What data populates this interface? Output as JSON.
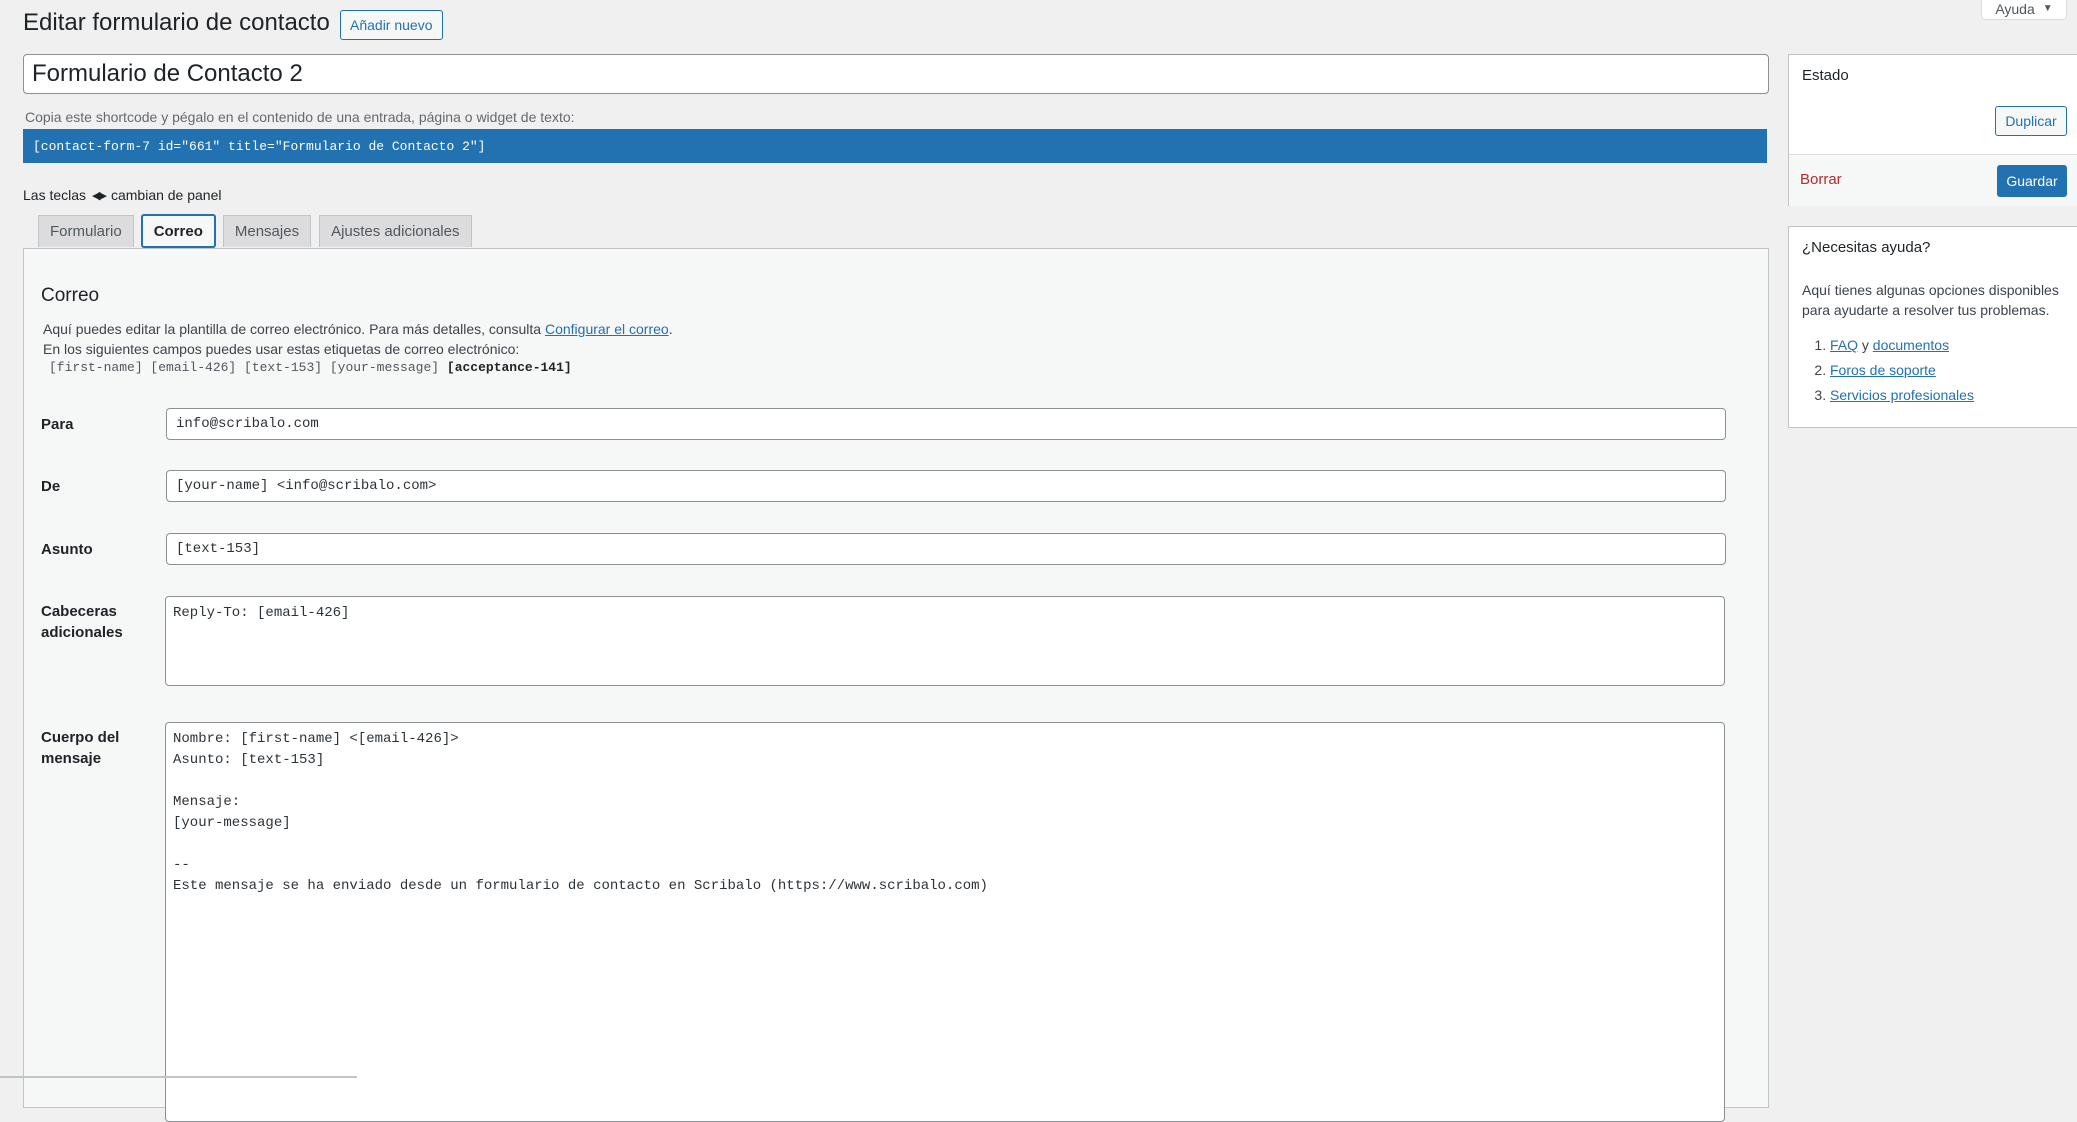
{
  "header": {
    "title": "Editar formulario de contacto",
    "add_new": "Añadir nuevo",
    "help": "Ayuda"
  },
  "form_title": "Formulario de Contacto 2",
  "shortcode": {
    "label": "Copia este shortcode y pégalo en el contenido de una entrada, página o widget de texto:",
    "value": "[contact-form-7 id=\"661\" title=\"Formulario de Contacto 2\"]"
  },
  "keys_hint": {
    "before": "Las teclas",
    "after": "cambian de panel"
  },
  "tabs": [
    {
      "label": "Formulario"
    },
    {
      "label": "Correo",
      "active": true
    },
    {
      "label": "Mensajes"
    },
    {
      "label": "Ajustes adicionales"
    }
  ],
  "mail": {
    "title": "Correo",
    "desc_text": "Aquí puedes editar la plantilla de correo electrónico. Para más detalles, consulta ",
    "desc_link": "Configurar el correo",
    "desc_end": ".",
    "tags_intro": "En los siguientes campos puedes usar estas etiquetas de correo electrónico:",
    "tags": "[first-name] [email-426] [text-153] [your-message]",
    "tags_bold": "[acceptance-141]",
    "to_label": "Para",
    "to_value": "info@scribalo.com",
    "from_label": "De",
    "from_value": "[your-name] <info@scribalo.com>",
    "subject_label": "Asunto",
    "subject_value": "[text-153]",
    "headers_label_1": "Cabeceras",
    "headers_label_2": "adicionales",
    "headers_value": "Reply-To: [email-426]",
    "body_label_1": "Cuerpo del",
    "body_label_2": "mensaje",
    "body_value": "Nombre: [first-name] <[email-426]>\nAsunto: [text-153]\n\nMensaje:\n[your-message]\n\n--\nEste mensaje se ha enviado desde un formulario de contacto en Scribalo (https://www.scribalo.com)"
  },
  "status_box": {
    "title": "Estado",
    "duplicate": "Duplicar",
    "delete": "Borrar",
    "save": "Guardar"
  },
  "help_box": {
    "title": "¿Necesitas ayuda?",
    "desc": "Aquí tienes algunas opciones disponibles para ayudarte a resolver tus problemas.",
    "item1_link1": "FAQ",
    "item1_sep": " y ",
    "item1_link2": "documentos",
    "item2": "Foros de soporte",
    "item3": "Servicios profesionales"
  }
}
